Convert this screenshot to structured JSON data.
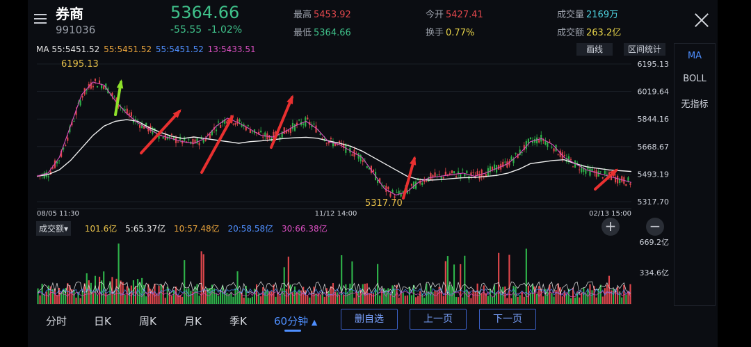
{
  "header": {
    "name": "券商",
    "code": "991036",
    "price": "5364.66",
    "change": "-55.55",
    "change_pct": "-1.02%",
    "high_label": "最高",
    "high": "5453.92",
    "low_label": "最低",
    "low": "5364.66",
    "open_label": "今开",
    "open": "5427.41",
    "turnover_label": "换手",
    "turnover": "0.77%",
    "volume_label": "成交量",
    "volume": "2169万",
    "amount_label": "成交额",
    "amount": "263.2亿"
  },
  "ma_legend": [
    {
      "text": "MA 55:5451.52",
      "color": "#e6e6e6"
    },
    {
      "text": "55:5451.52",
      "color": "#e8a33c"
    },
    {
      "text": "55:5451.52",
      "color": "#4f8fff"
    },
    {
      "text": "13:5433.51",
      "color": "#d94fc0"
    }
  ],
  "toolbar": {
    "draw_label": "画线",
    "stats_label": "区间统计"
  },
  "side_panel": [
    "MA",
    "BOLL",
    "无指标"
  ],
  "price_axis": [
    "6195.13",
    "6019.64",
    "5844.16",
    "5668.67",
    "5493.19",
    "5317.70"
  ],
  "time_axis": [
    "08/05  11:30",
    "11/12  14:00",
    "02/13  15:00"
  ],
  "annotations": {
    "max": "6195.13",
    "min": "5317.70"
  },
  "volume": {
    "tag": "成交额",
    "values": [
      {
        "text": "101.6亿",
        "color": "#e8c14a"
      },
      {
        "text": "5:65.37亿",
        "color": "#e6e6e6"
      },
      {
        "text": "10:57.48亿",
        "color": "#e8a33c"
      },
      {
        "text": "20:58.58亿",
        "color": "#4f8fff"
      },
      {
        "text": "30:66.38亿",
        "color": "#d94fc0"
      }
    ],
    "axis": [
      "669.2亿",
      "334.6亿"
    ]
  },
  "zoom": {
    "in": "+",
    "out": "−"
  },
  "tabs": [
    "分时",
    "日K",
    "周K",
    "月K",
    "季K",
    "60分钟"
  ],
  "active_tab": "60分钟",
  "page_buttons": [
    "删自选",
    "上一页",
    "下一页"
  ],
  "colors": {
    "up": "#e0474c",
    "down": "#2fb34a",
    "accent": "#4f8fff",
    "bg": "#0b0d12"
  },
  "chart_data": {
    "type": "candlestick",
    "y_range": [
      5317.7,
      6195.13
    ],
    "ma_series": [
      {
        "name": "MA55 (white)",
        "values": [
          5480,
          5490,
          5520,
          5580,
          5660,
          5740,
          5800,
          5830,
          5840,
          5830,
          5790,
          5760,
          5735,
          5720,
          5730,
          5720,
          5710,
          5700,
          5690,
          5700,
          5705,
          5712,
          5720,
          5725,
          5728,
          5722,
          5705,
          5690,
          5670,
          5640,
          5600,
          5560,
          5520,
          5480,
          5460,
          5455,
          5458,
          5465,
          5470,
          5472,
          5478,
          5485,
          5500,
          5525,
          5560,
          5570,
          5580,
          5585,
          5560,
          5540,
          5530,
          5520,
          5515,
          5510
        ]
      },
      {
        "name": "MA13 (magenta)",
        "values": [
          5480,
          5500,
          5600,
          5800,
          6000,
          6080,
          6060,
          5960,
          5880,
          5820,
          5780,
          5740,
          5720,
          5700,
          5690,
          5720,
          5800,
          5850,
          5820,
          5780,
          5740,
          5730,
          5760,
          5800,
          5830,
          5780,
          5700,
          5680,
          5640,
          5600,
          5500,
          5400,
          5360,
          5380,
          5440,
          5470,
          5480,
          5490,
          5500,
          5480,
          5500,
          5530,
          5560,
          5620,
          5700,
          5720,
          5680,
          5600,
          5560,
          5520,
          5500,
          5480,
          5460,
          5440
        ]
      }
    ]
  }
}
